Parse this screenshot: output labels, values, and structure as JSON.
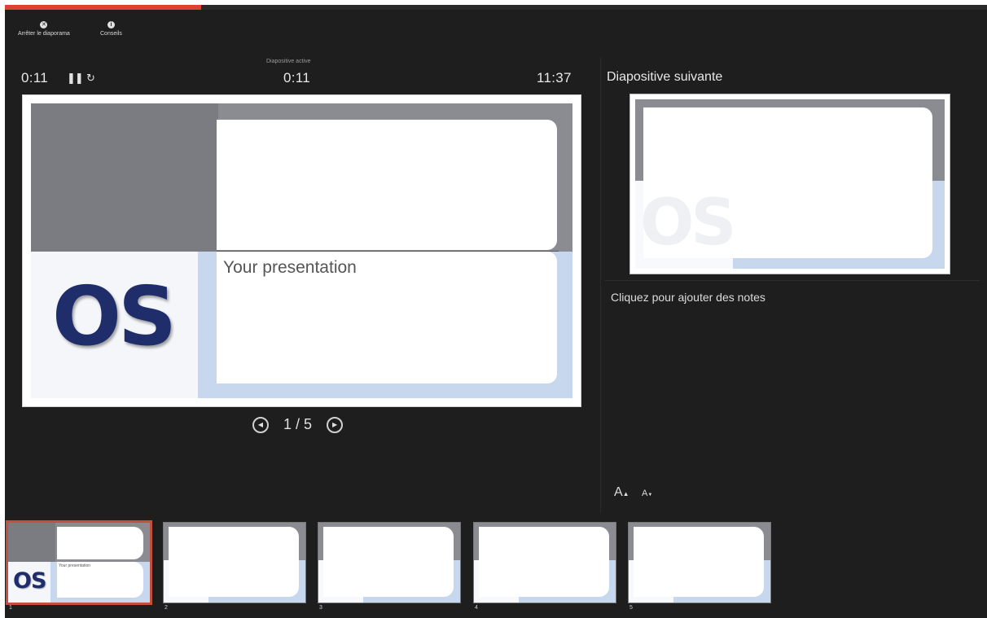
{
  "progress": {
    "fraction": 0.2
  },
  "toolbar": {
    "end_show_label": "Arrêter le diaporama",
    "end_show_icon": "close-circle-icon",
    "tips_label": "Conseils",
    "tips_icon": "info-circle-icon"
  },
  "timers": {
    "elapsed": "0:11",
    "active_slide_label": "Diapositive active",
    "active_slide_time": "0:11",
    "clock": "11:37"
  },
  "controls": {
    "pause_icon": "pause-icon",
    "restart_icon": "restart-icon"
  },
  "slide": {
    "title": "Your presentation",
    "logo_text": "OS",
    "colors": {
      "gray": "#7b7c82",
      "light_blue": "#c7d8ee",
      "accent": "#1f2d6a"
    }
  },
  "navigation": {
    "counter": "1 / 5",
    "prev_icon": "prev-circle-icon",
    "next_icon": "next-circle-icon"
  },
  "next_slide": {
    "title": "Diapositive suivante",
    "logo_text": "OS"
  },
  "notes": {
    "placeholder": "Cliquez pour ajouter des notes"
  },
  "font_controls": {
    "increase_label": "A",
    "decrease_label": "A"
  },
  "filmstrip": {
    "thumbnails": [
      {
        "number": "1",
        "title": "Your presentation",
        "logo": "OS"
      },
      {
        "number": "2"
      },
      {
        "number": "3"
      },
      {
        "number": "4"
      },
      {
        "number": "5"
      }
    ]
  }
}
